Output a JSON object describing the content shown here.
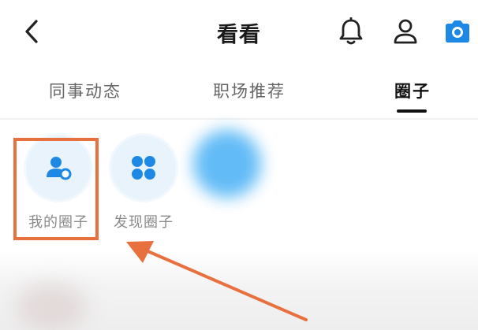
{
  "header": {
    "title": "看看",
    "icons": [
      "back-arrow-icon",
      "bell-icon",
      "user-icon",
      "camera-icon"
    ]
  },
  "tabs": [
    {
      "label": "同事动态",
      "active": false
    },
    {
      "label": "职场推荐",
      "active": false
    },
    {
      "label": "圈子",
      "active": true
    }
  ],
  "circles": [
    {
      "label": "我的圈子",
      "icon": "my-circle-icon"
    },
    {
      "label": "发现圈子",
      "icon": "discover-circle-icon"
    }
  ],
  "colors": {
    "accent_blue": "#1e88e5",
    "highlight_orange": "#e8703e"
  }
}
